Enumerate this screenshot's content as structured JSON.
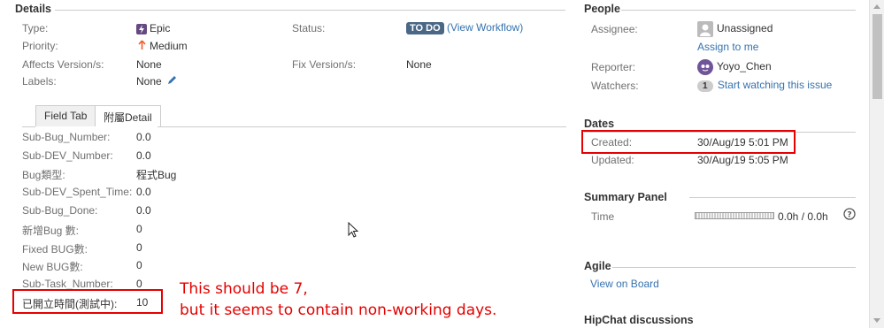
{
  "details": {
    "heading": "Details",
    "left_fields": [
      {
        "label": "Type:",
        "value": "Epic"
      },
      {
        "label": "Priority:",
        "value": "Medium"
      },
      {
        "label": "Affects Version/s:",
        "value": "None"
      },
      {
        "label": "Labels:",
        "value": "None"
      }
    ],
    "status_label": "Status:",
    "status_value": "TO DO",
    "view_workflow": "(View Workflow)",
    "fix_label": "Fix Version/s:",
    "fix_value": "None"
  },
  "tabs": {
    "field_tab": "Field Tab",
    "detail_tab": "附屬Detail"
  },
  "custom_fields": [
    {
      "label": "Sub-Bug_Number:",
      "value": "0.0"
    },
    {
      "label": "Sub-DEV_Number:",
      "value": "0.0"
    },
    {
      "label": "Bug類型:",
      "value": "程式Bug"
    },
    {
      "label": "Sub-DEV_Spent_Time:",
      "value": "0.0"
    },
    {
      "label": "Sub-Bug_Done:",
      "value": "0.0"
    },
    {
      "label": "新增Bug 數:",
      "value": "0"
    },
    {
      "label": "Fixed BUG數:",
      "value": "0"
    },
    {
      "label": "New BUG數:",
      "value": "0"
    },
    {
      "label": "Sub-Task_Number:",
      "value": "0"
    },
    {
      "label": "已開立時間(測試中):",
      "value": "10"
    }
  ],
  "annotation": {
    "line1": "This should be 7,",
    "line2": "but it seems to contain non-working days."
  },
  "people": {
    "heading": "People",
    "assignee_label": "Assignee:",
    "assignee_value": "Unassigned",
    "assign_to_me": "Assign to me",
    "reporter_label": "Reporter:",
    "reporter_value": "Yoyo_Chen",
    "watchers_label": "Watchers:",
    "watchers_count": "1",
    "start_watching": "Start watching this issue"
  },
  "dates": {
    "heading": "Dates",
    "created_label": "Created:",
    "created_value": "30/Aug/19 5:01 PM",
    "updated_label": "Updated:",
    "updated_value": "30/Aug/19 5:05 PM"
  },
  "summary_panel": {
    "heading": "Summary Panel",
    "time_label": "Time",
    "time_value": "0.0h / 0.0h",
    "progress": 0
  },
  "agile": {
    "heading": "Agile",
    "view_on_board": "View on Board"
  },
  "hipchat": {
    "heading": "HipChat discussions"
  },
  "colors": {
    "link": "#3572b0",
    "annotation_red": "#e60000",
    "status_badge": "#4a6785",
    "epic_purple": "#654982",
    "priority_orange": "#f15c2c"
  }
}
